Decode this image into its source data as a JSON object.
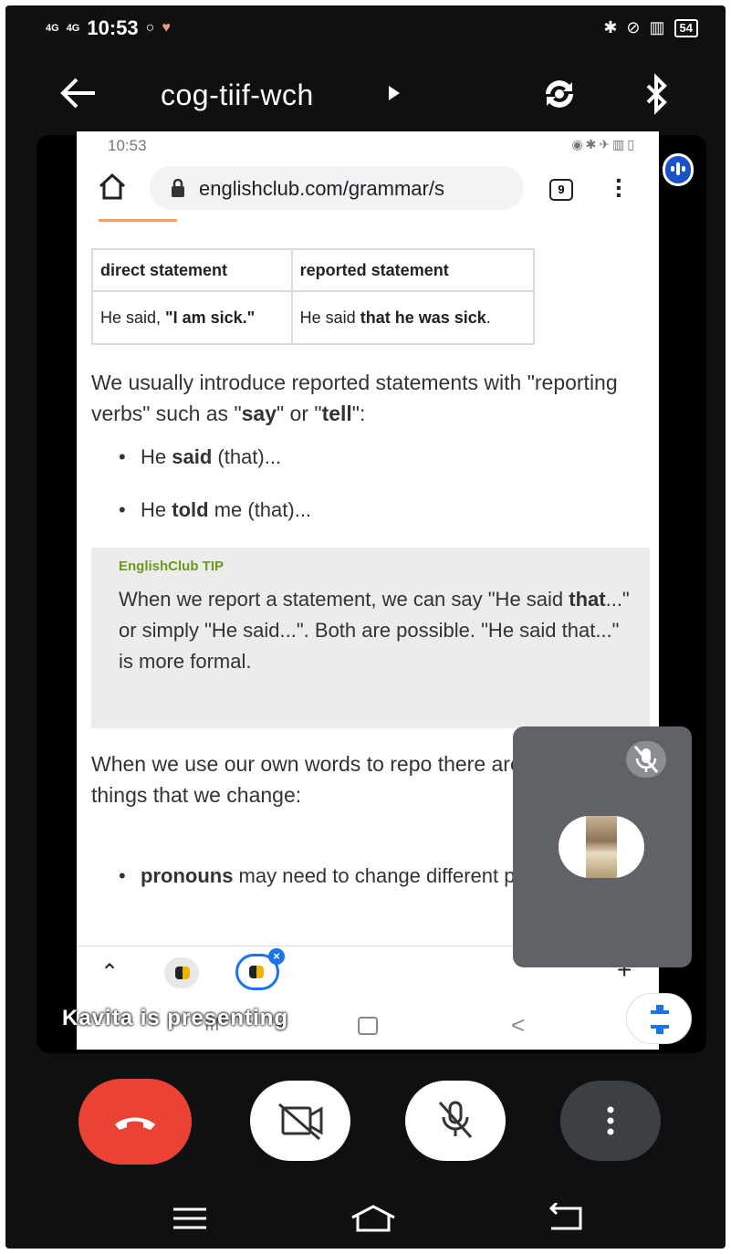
{
  "status_bar": {
    "signal1": "4G",
    "signal2": "4G",
    "time": "10:53",
    "battery": "54"
  },
  "top_bar": {
    "meeting_code": "cog-tiif-wch"
  },
  "shared_screen": {
    "status_time": "10:53",
    "url": "englishclub.com/grammar/s",
    "tab_count": "9",
    "table": {
      "headers": [
        "direct statement",
        "reported statement"
      ],
      "row": {
        "direct_prefix": "He said, ",
        "direct_bold": "\"I am sick.\"",
        "reported_prefix": "He said ",
        "reported_bold": "that he was sick",
        "reported_suffix": "."
      }
    },
    "para1": {
      "a": "We usually introduce reported statements with \"reporting verbs\" such as \"",
      "b": "say",
      "c": "\" or \"",
      "d": "tell",
      "e": "\":"
    },
    "bullets": [
      {
        "a": "He ",
        "b": "said",
        "c": " (that)..."
      },
      {
        "a": "He ",
        "b": "told",
        "c": " me (that)..."
      }
    ],
    "tip": {
      "title": "EnglishClub TIP",
      "a": "When we report a statement, we can say \"He said ",
      "b": "that",
      "c": "...\" or simply \"He said...\". Both are possible. \"He said that...\" is more formal."
    },
    "para2": "When we use our own words to repo there are one or two things that we change:",
    "bullet2": {
      "b": "pronouns",
      "c": " may need to change different perspective"
    }
  },
  "presenting_label": "Kavita is presenting",
  "colors": {
    "end_call": "#ea4335",
    "accent_blue": "#1a73e8",
    "tip_green": "#6a9a1a"
  }
}
